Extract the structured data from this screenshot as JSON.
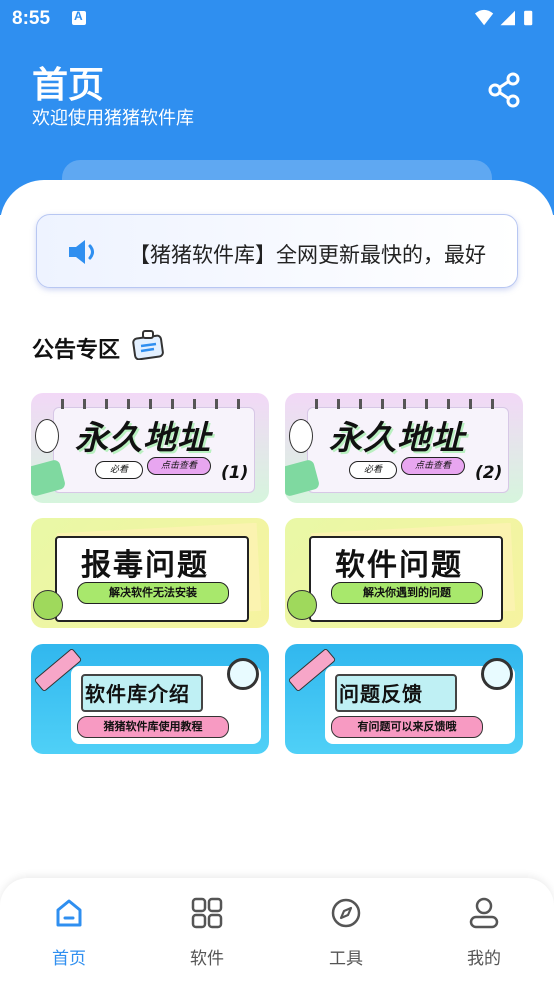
{
  "status_bar": {
    "time": "8:55"
  },
  "header": {
    "title": "首页",
    "subtitle": "欢迎使用猪猪软件库"
  },
  "notice": {
    "text": "【猪猪软件库】全网更新最快的，最好"
  },
  "announcements": {
    "title": "公告专区",
    "cards": [
      {
        "style": "address",
        "title": "永久地址",
        "tag1": "必看",
        "tag2": "点击查看",
        "num": "(1)"
      },
      {
        "style": "address",
        "title": "永久地址",
        "tag1": "必看",
        "tag2": "点击查看",
        "num": "(2)"
      },
      {
        "style": "issue",
        "title": "报毒问题",
        "sub": "解决软件无法安装"
      },
      {
        "style": "issue",
        "title": "软件问题",
        "sub": "解决你遇到的问题"
      },
      {
        "style": "intro",
        "title": "软件库介绍",
        "sub": "猪猪软件库使用教程"
      },
      {
        "style": "intro",
        "title": "问题反馈",
        "sub": "有问题可以来反馈哦"
      }
    ]
  },
  "tabs": [
    {
      "label": "首页",
      "icon": "home-icon",
      "active": true
    },
    {
      "label": "软件",
      "icon": "grid-icon",
      "active": false
    },
    {
      "label": "工具",
      "icon": "compass-icon",
      "active": false
    },
    {
      "label": "我的",
      "icon": "person-icon",
      "active": false
    }
  ],
  "colors": {
    "primary": "#2f8ff0"
  }
}
